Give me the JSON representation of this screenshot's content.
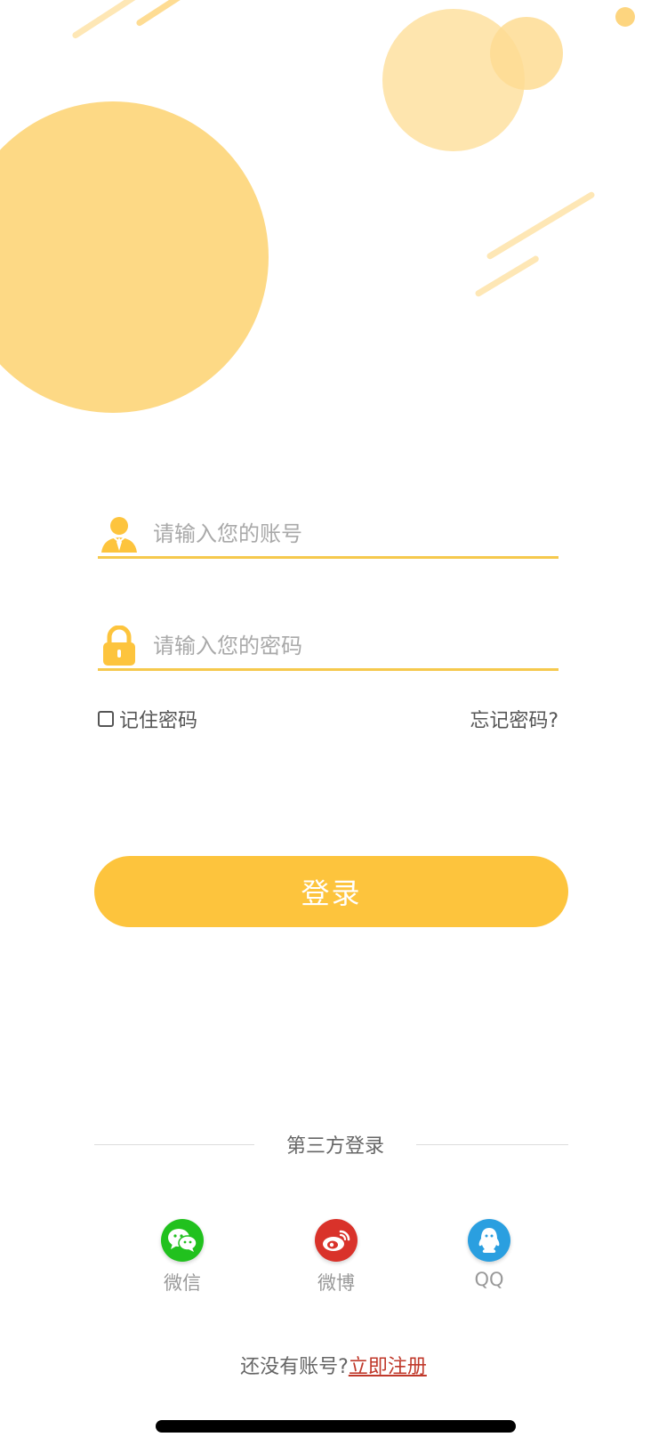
{
  "colors": {
    "accent": "#fdc43d",
    "underline": "#f6c94d",
    "link": "#c0392b",
    "wechat": "#21c11e",
    "weibo": "#d9322a",
    "qq": "#2a9fe0"
  },
  "form": {
    "username_placeholder": "请输入您的账号",
    "password_placeholder": "请输入您的密码",
    "remember_label": "记住密码",
    "forgot_label": "忘记密码?",
    "login_label": "登录"
  },
  "third_party": {
    "title": "第三方登录",
    "providers": [
      {
        "label": "微信",
        "icon": "wechat-icon"
      },
      {
        "label": "微博",
        "icon": "weibo-icon"
      },
      {
        "label": "QQ",
        "icon": "qq-icon"
      }
    ]
  },
  "signup": {
    "prompt": "还没有账号?",
    "link": "立即注册"
  }
}
